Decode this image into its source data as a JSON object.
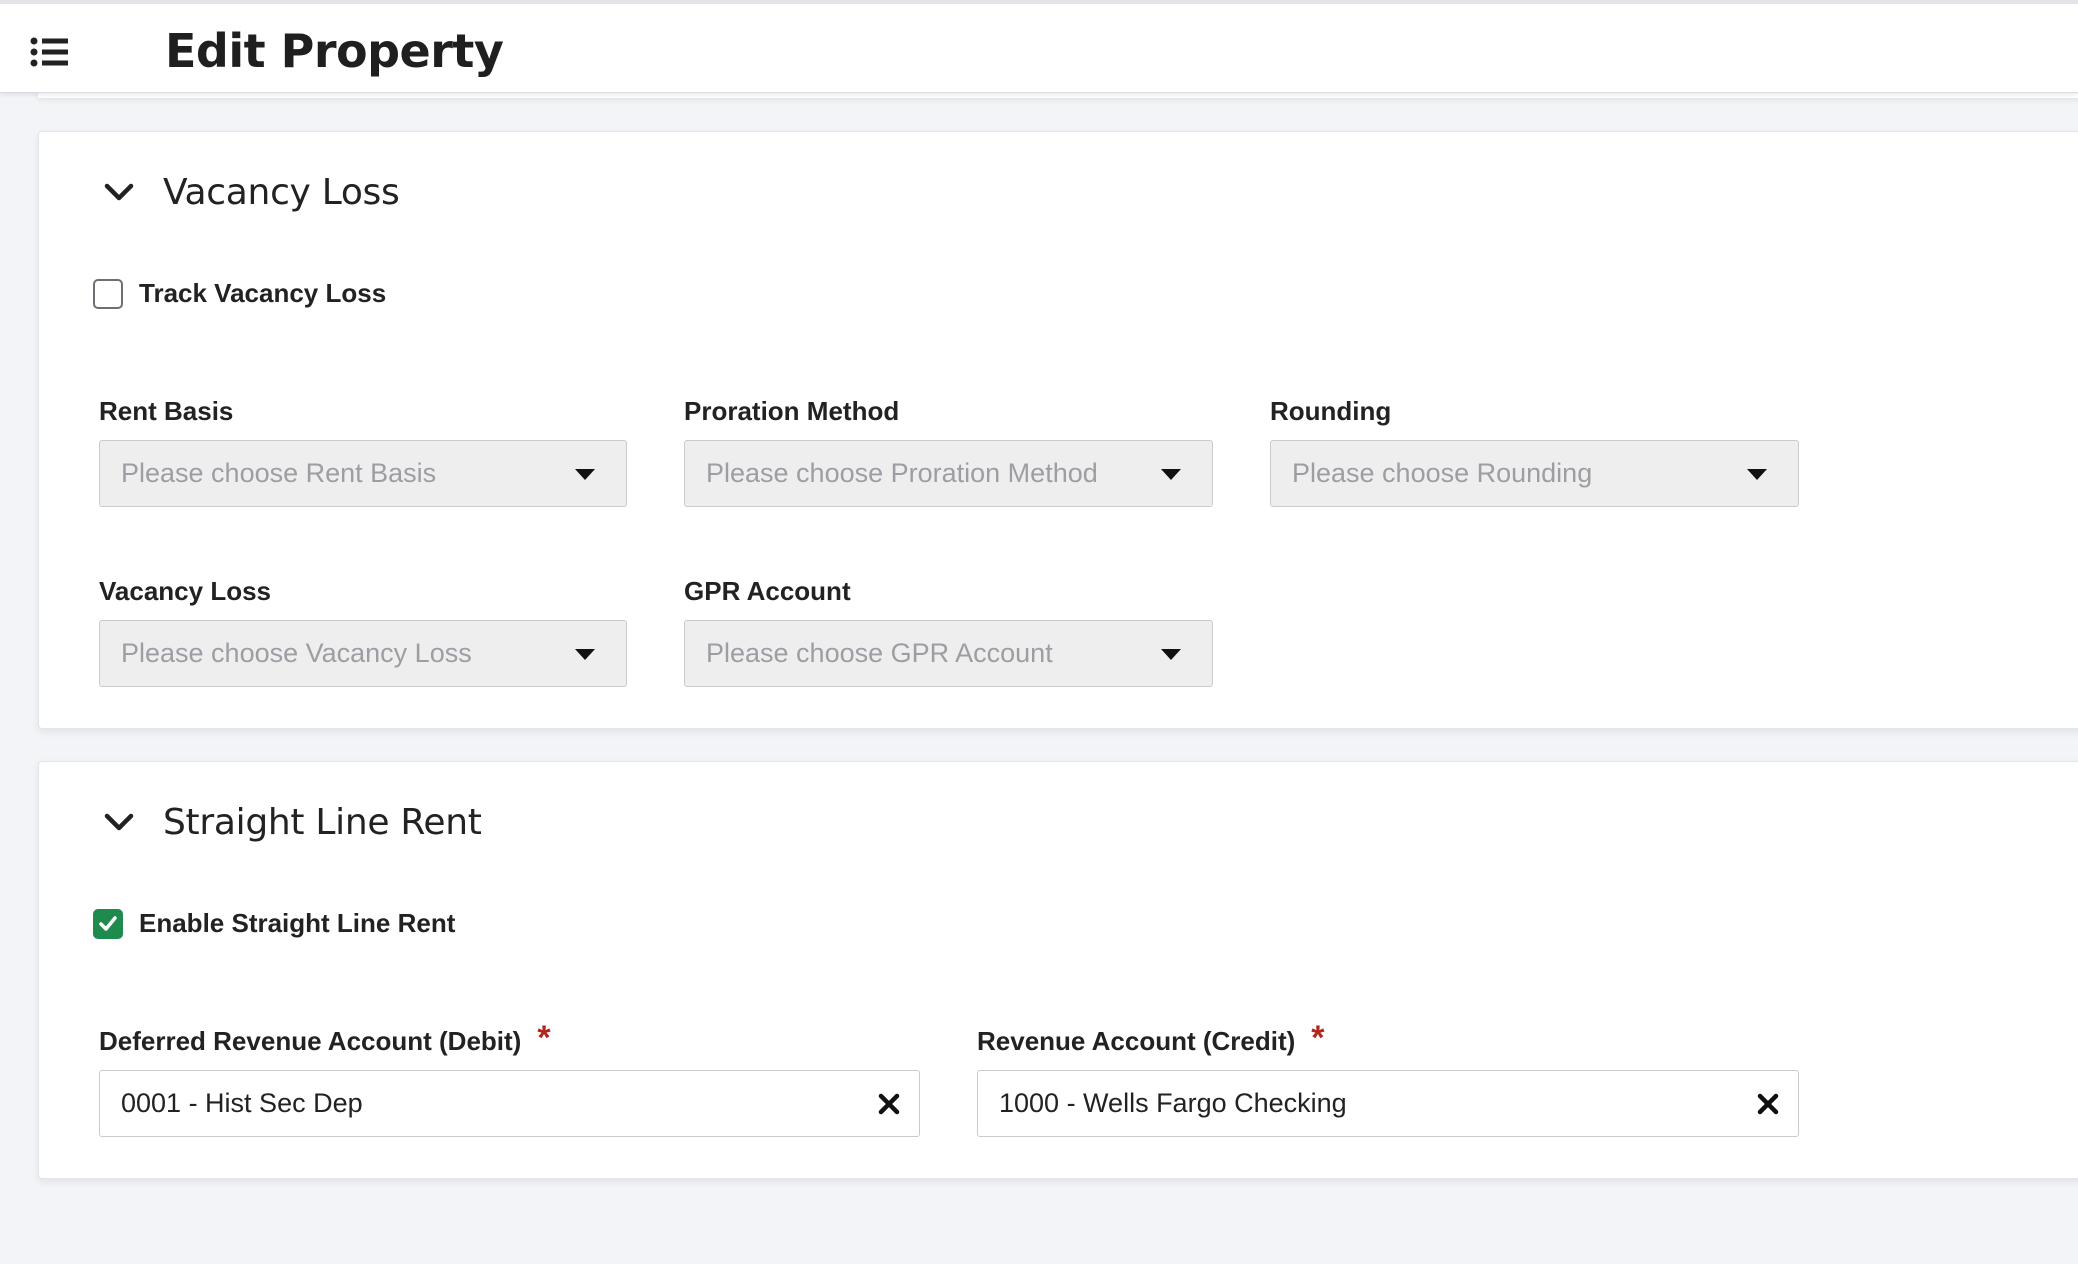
{
  "header": {
    "title": "Edit Property",
    "menu_icon": "list-icon"
  },
  "vacancy_loss": {
    "title": "Vacancy Loss",
    "track_label": "Track Vacancy Loss",
    "track_checked": false,
    "rent_basis": {
      "label": "Rent Basis",
      "placeholder": "Please choose Rent Basis"
    },
    "proration_method": {
      "label": "Proration Method",
      "placeholder": "Please choose Proration Method"
    },
    "rounding": {
      "label": "Rounding",
      "placeholder": "Please choose Rounding"
    },
    "vacancy_loss_account": {
      "label": "Vacancy Loss",
      "placeholder": "Please choose Vacancy Loss"
    },
    "gpr_account": {
      "label": "GPR Account",
      "placeholder": "Please choose GPR Account"
    }
  },
  "straight_line_rent": {
    "title": "Straight Line Rent",
    "enable_label": "Enable Straight Line Rent",
    "enable_checked": true,
    "deferred_revenue": {
      "label": "Deferred Revenue Account (Debit)",
      "required_mark": "*",
      "value": "0001 - Hist Sec Dep"
    },
    "revenue_account": {
      "label": "Revenue Account (Credit)",
      "required_mark": "*",
      "value": "1000 - Wells Fargo Checking"
    }
  },
  "colors": {
    "checkbox_checked": "#1e8a4d",
    "required": "#b3261e",
    "page_bg": "#f2f4f7"
  }
}
